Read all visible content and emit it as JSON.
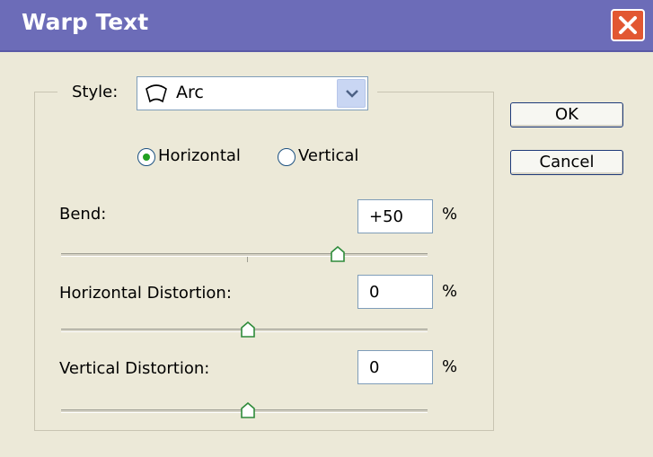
{
  "window": {
    "title": "Warp Text"
  },
  "style": {
    "label": "Style:",
    "value": "Arc",
    "icon": "arc-warp-icon"
  },
  "orientation": {
    "options": [
      "Horizontal",
      "Vertical"
    ],
    "selected": "Horizontal"
  },
  "bend": {
    "label": "Bend:",
    "value": "+50",
    "unit": "%",
    "slider_fraction": 0.75
  },
  "horizontal_distortion": {
    "label": "Horizontal Distortion:",
    "value": "0",
    "unit": "%",
    "slider_fraction": 0.5
  },
  "vertical_distortion": {
    "label": "Vertical Distortion:",
    "value": "0",
    "unit": "%",
    "slider_fraction": 0.5
  },
  "buttons": {
    "ok": "OK",
    "cancel": "Cancel"
  },
  "colors": {
    "titlebar": "#6c6cb8",
    "dialog_bg": "#ece9d8",
    "close": "#e25732",
    "radio_dot": "#21a121",
    "thumb": "#2e8b3a"
  }
}
